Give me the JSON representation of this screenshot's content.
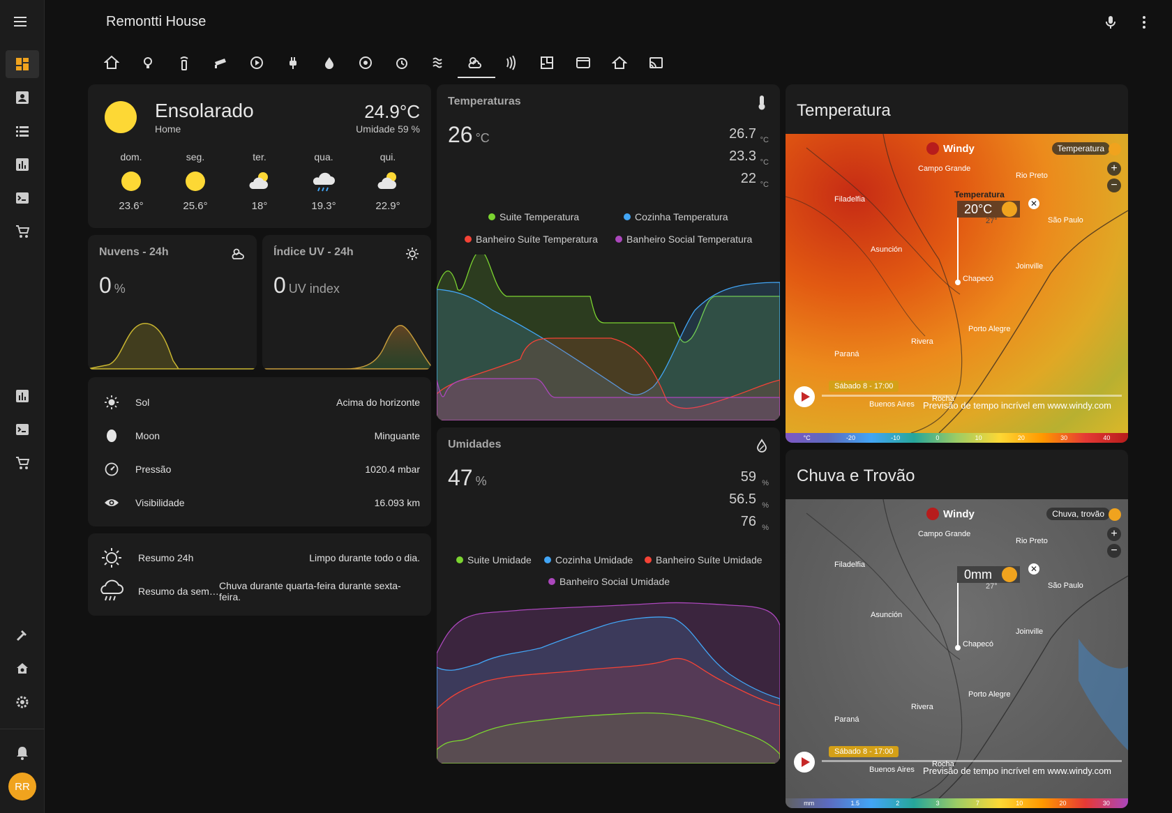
{
  "header": {
    "title": "Remontti House",
    "menu_icon": "menu-icon",
    "mic_icon": "microphone-icon",
    "more_icon": "more-vert-icon"
  },
  "sidebar": {
    "user_initials": "RR"
  },
  "tabs": [
    "home-tab",
    "lights-tab",
    "remote-tab",
    "camera-tab",
    "media-tab",
    "power-tab",
    "water-tab",
    "security-tab",
    "alarm-tab",
    "energy-tab",
    "weather-tab",
    "signal-tab",
    "floorplan-tab",
    "media-player-tab",
    "house-tab",
    "cast-tab"
  ],
  "weather": {
    "condition": "Ensolarado",
    "location": "Home",
    "temperature": "24.9°C",
    "humidity": "Umidade 59 %",
    "forecast": [
      {
        "day": "dom.",
        "temp": "23.6°",
        "icon": "sunny-icon"
      },
      {
        "day": "seg.",
        "temp": "25.6°",
        "icon": "sunny-icon"
      },
      {
        "day": "ter.",
        "temp": "18°",
        "icon": "partly-cloudy-icon"
      },
      {
        "day": "qua.",
        "temp": "19.3°",
        "icon": "rainy-icon"
      },
      {
        "day": "qui.",
        "temp": "22.9°",
        "icon": "partly-cloudy-icon"
      }
    ]
  },
  "clouds": {
    "title": "Nuvens - 24h",
    "value": "0",
    "unit": "%"
  },
  "uv": {
    "title": "Índice UV - 24h",
    "value": "0",
    "unit": "UV index"
  },
  "info": [
    {
      "label": "Sol",
      "value": "Acima do horizonte",
      "icon": "sun-icon"
    },
    {
      "label": "Moon",
      "value": "Minguante",
      "icon": "moon-icon"
    },
    {
      "label": "Pressão",
      "value": "1020.4 mbar",
      "icon": "gauge-icon"
    },
    {
      "label": "Visibilidade",
      "value": "16.093 km",
      "icon": "eye-icon"
    }
  ],
  "summary": [
    {
      "label": "Resumo 24h",
      "value": "Limpo durante todo o dia.",
      "icon": "sun-outline-icon"
    },
    {
      "label": "Resumo da sem…",
      "value": "Chuva durante quarta-feira durante sexta-feira.",
      "icon": "storm-icon"
    }
  ],
  "temps": {
    "title": "Temperaturas",
    "main": "26",
    "unit": "°C",
    "side": [
      "26.7",
      "23.3",
      "22"
    ],
    "legend": [
      "Suite Temperatura",
      "Cozinha Temperatura",
      "Banheiro Suíte Temperatura",
      "Banheiro Social Temperatura"
    ]
  },
  "hum": {
    "title": "Umidades",
    "main": "47",
    "unit": "%",
    "side": [
      "59",
      "56.5",
      "76"
    ],
    "legend": [
      "Suite Umidade",
      "Cozinha Umidade",
      "Banheiro Suíte Umidade",
      "Banheiro Social Umidade"
    ]
  },
  "map1": {
    "title": "Temperatura",
    "layer": "Temperatura",
    "popup_label": "Temperatura",
    "popup_value": "20°C",
    "popup_sub": "27°",
    "time": "Sábado 8 - 17:00",
    "footer": "Previsão de tempo incrível em www.windy.com",
    "scale": [
      "°C",
      "-20",
      "-10",
      "0",
      "10",
      "20",
      "30",
      "40"
    ]
  },
  "map2": {
    "title": "Chuva e Trovão",
    "layer": "Chuva, trovão",
    "popup_value": "0mm",
    "popup_sub": "27°",
    "time": "Sábado 8 - 17:00",
    "footer": "Previsão de tempo incrível em www.windy.com",
    "scale": [
      "mm",
      "1.5",
      "2",
      "3",
      "7",
      "10",
      "20",
      "30"
    ]
  },
  "map_labels": [
    "Campo Grande",
    "Rio Preto",
    "Filadelfia",
    "Asunción",
    "São Paulo",
    "Joinville",
    "Chapecó",
    "Porto Alegre",
    "Rivera",
    "Paraná",
    "Buenos Aires",
    "Rocha"
  ],
  "windy_brand": "Windy",
  "colors": {
    "accent_orange": "#f0a31e",
    "sun_yellow": "#fdd835",
    "green": "#8bc34a",
    "blue": "#42a5f5",
    "red": "#f44336",
    "purple": "#ab47bc"
  }
}
